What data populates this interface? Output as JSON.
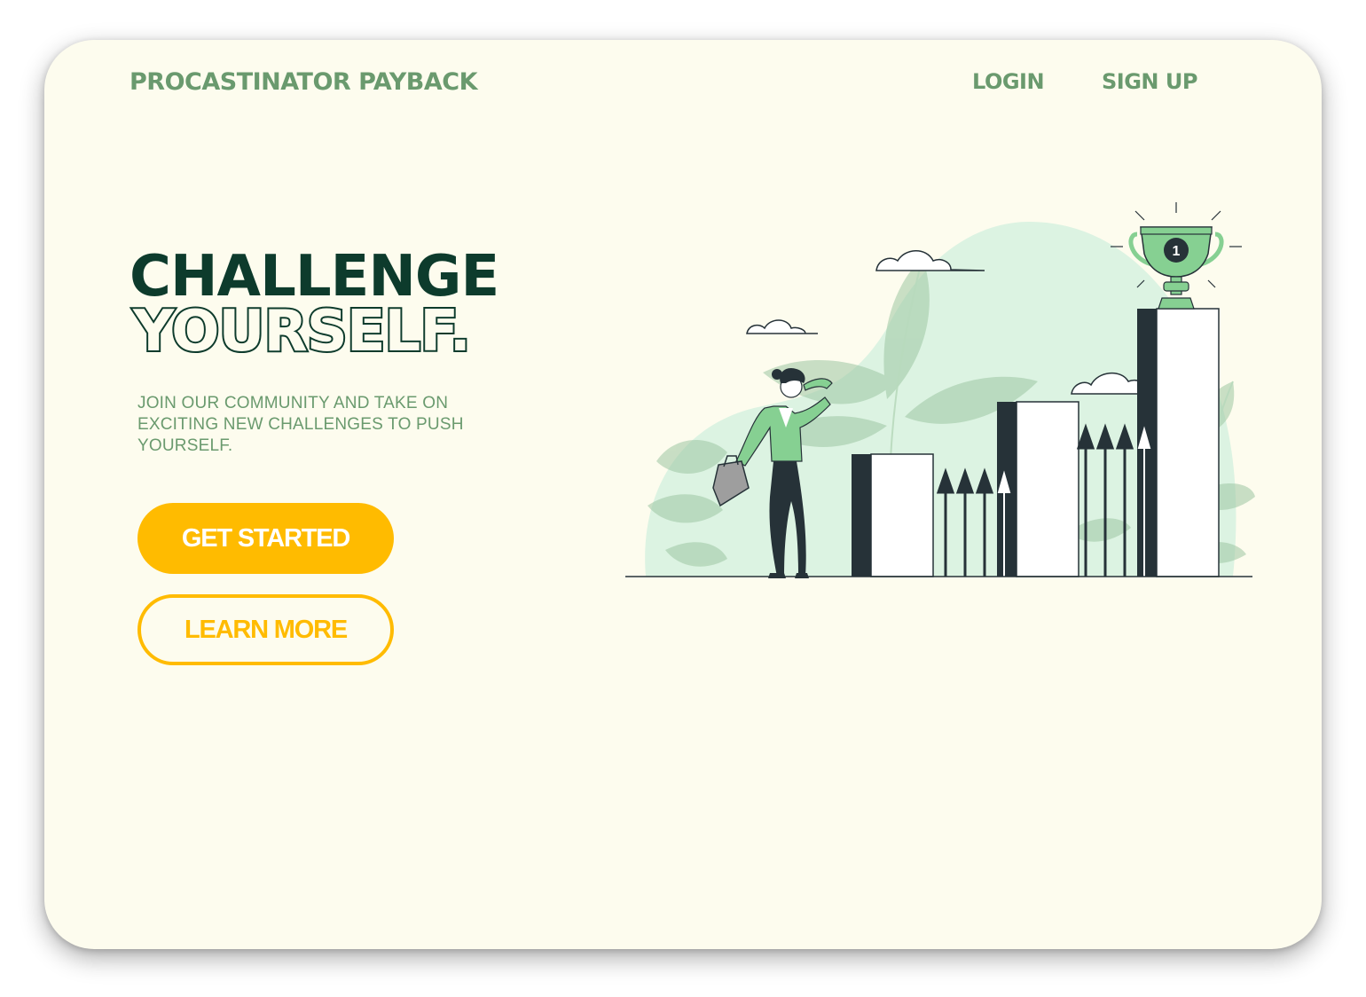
{
  "header": {
    "brand": "PROCASTINATOR PAYBACK",
    "nav": {
      "login": "LOGIN",
      "signup": "SIGN UP"
    }
  },
  "hero": {
    "headline_line1": "CHALLENGE",
    "headline_line2": "YOURSELF.",
    "subtext": "JOIN OUR COMMUNITY AND TAKE ON EXCITING NEW CHALLENGES TO PUSH YOURSELF.",
    "primary_button": "GET STARTED",
    "secondary_button": "LEARN MORE"
  },
  "illustration": {
    "trophy_rank": "1"
  },
  "colors": {
    "background": "#fdfcee",
    "brand_green": "#6a9a6e",
    "headline_dark": "#0d3b2c",
    "accent_yellow": "#ffbb00",
    "illustration_mint": "#dcf3e2",
    "illustration_green": "#86d092",
    "illustration_dark": "#263238"
  }
}
